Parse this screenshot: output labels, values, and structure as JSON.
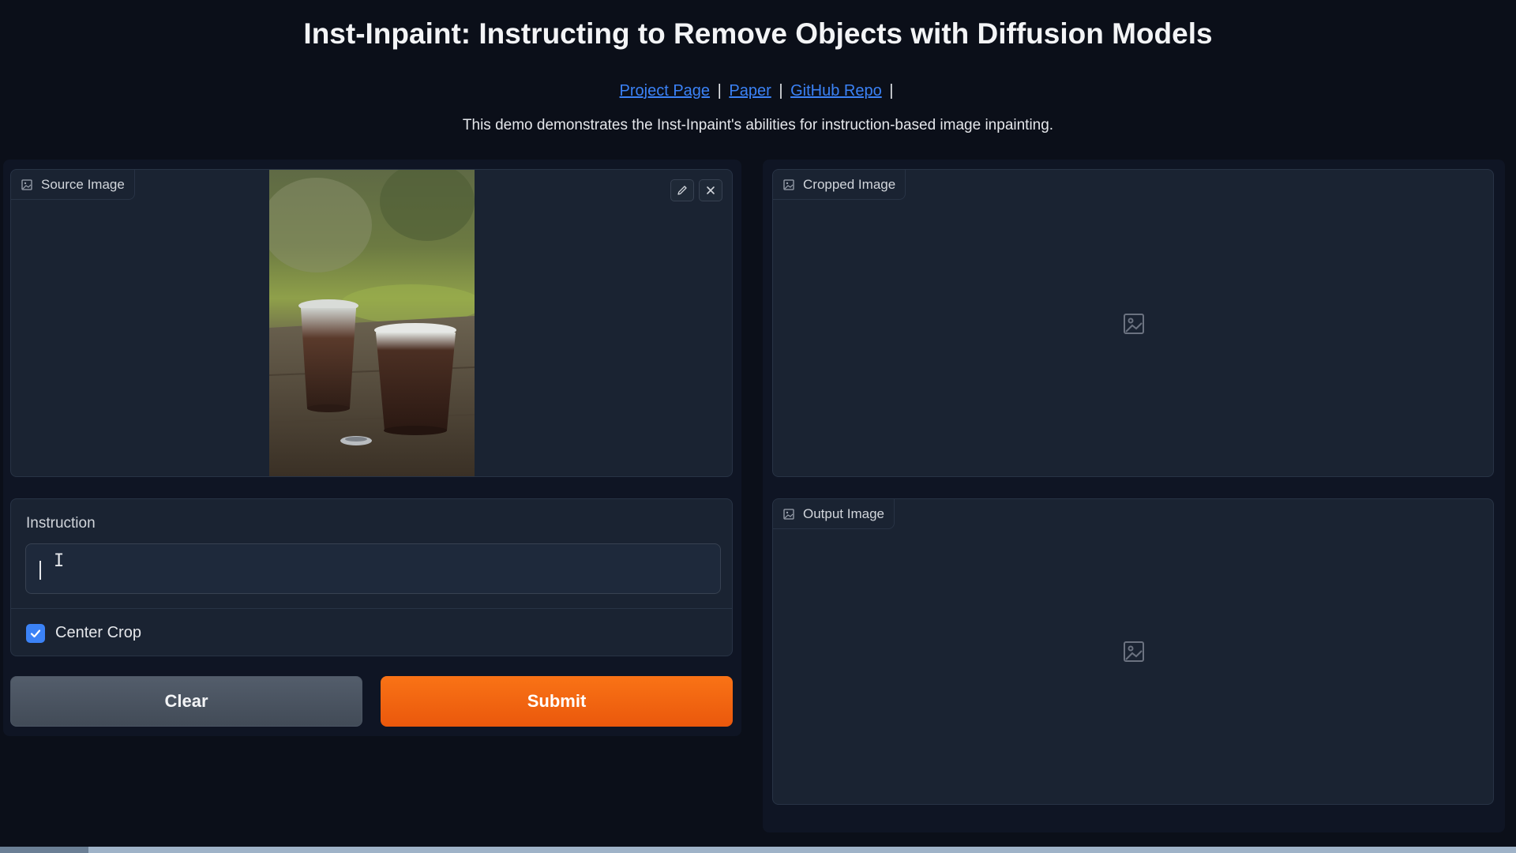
{
  "header": {
    "title": "Inst-Inpaint: Instructing to Remove Objects with Diffusion Models",
    "links": [
      "Project Page",
      "Paper",
      "GitHub Repo"
    ],
    "separator": "|",
    "description": "This demo demonstrates the Inst-Inpaint's abilities for instruction-based image inpainting."
  },
  "source_panel": {
    "label": "Source Image",
    "label_icon": "image-icon",
    "edit_icon": "pencil-icon",
    "clear_icon": "close-icon"
  },
  "cropped_panel": {
    "label": "Cropped Image",
    "label_icon": "image-icon",
    "placeholder_icon": "image-placeholder-icon"
  },
  "output_panel": {
    "label": "Output Image",
    "label_icon": "image-icon",
    "placeholder_icon": "image-placeholder-icon"
  },
  "instruction": {
    "label": "Instruction",
    "value": ""
  },
  "center_crop": {
    "label": "Center Crop",
    "checked": true
  },
  "buttons": {
    "clear": "Clear",
    "submit": "Submit"
  },
  "colors": {
    "accent_orange": "#f97316",
    "link_blue": "#3b82f6",
    "background": "#0b0f19",
    "panel": "#1a2332"
  }
}
